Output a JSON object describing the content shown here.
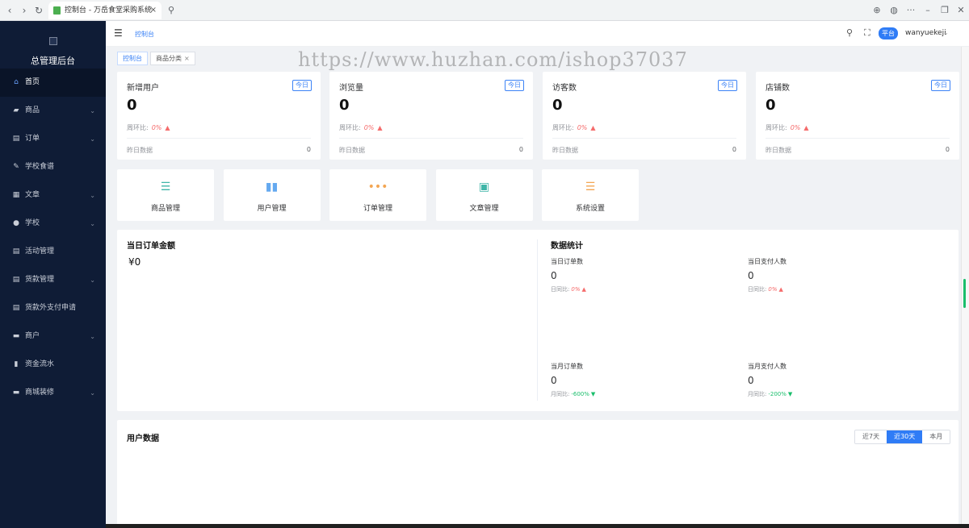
{
  "browser": {
    "tab_title": "控制台 - 万岳食堂采购系统",
    "back": "‹",
    "forward": "›",
    "reload": "↻",
    "tab_close": "×",
    "search_glyph": "⚲",
    "download_glyph": "⊕",
    "globe_glyph": "◍",
    "more_glyph": "···",
    "min_glyph": "–",
    "restore_glyph": "❐",
    "close_glyph": "✕"
  },
  "sidebar": {
    "brand": "总管理后台",
    "items": [
      {
        "label": "首页",
        "icon": "home-icon",
        "glyph": "⌂",
        "arrow": false
      },
      {
        "label": "商品",
        "icon": "bag-icon",
        "glyph": "▰",
        "arrow": true
      },
      {
        "label": "订单",
        "icon": "order-icon",
        "glyph": "▤",
        "arrow": true
      },
      {
        "label": "学校食谱",
        "icon": "edit-icon",
        "glyph": "✎",
        "arrow": false
      },
      {
        "label": "文章",
        "icon": "article-icon",
        "glyph": "▦",
        "arrow": true
      },
      {
        "label": "学校",
        "icon": "user-icon",
        "glyph": "●",
        "arrow": true
      },
      {
        "label": "活动管理",
        "icon": "list-icon",
        "glyph": "▤",
        "arrow": false
      },
      {
        "label": "货款管理",
        "icon": "doc-icon",
        "glyph": "▤",
        "arrow": true
      },
      {
        "label": "货款外支付申请",
        "icon": "doc-icon",
        "glyph": "▤",
        "arrow": false
      },
      {
        "label": "商户",
        "icon": "shop-icon",
        "glyph": "▬",
        "arrow": true
      },
      {
        "label": "资金流水",
        "icon": "bar-chart-icon",
        "glyph": "▮",
        "arrow": false
      },
      {
        "label": "商城装修",
        "icon": "brush-icon",
        "glyph": "▬",
        "arrow": true
      }
    ],
    "arrow_glyph": "⌄"
  },
  "header": {
    "menu_glyph": "☰",
    "breadcrumb": "控制台",
    "search_glyph": "⚲",
    "fullscreen_glyph": "⛶",
    "platform": "平台",
    "username": "wanyuekeji",
    "caret": "⌄"
  },
  "page_tabs": {
    "home": "控制台",
    "category": "商品分类",
    "close": "×"
  },
  "watermark": "https://www.huzhan.com/ishop37037",
  "stats": [
    {
      "title": "新增用户",
      "badge": "今日",
      "value": "0",
      "wow_label": "周环比:",
      "wow": "0%",
      "yday_label": "昨日数据",
      "yday": "0"
    },
    {
      "title": "浏览量",
      "badge": "今日",
      "value": "0",
      "wow_label": "周环比:",
      "wow": "0%",
      "yday_label": "昨日数据",
      "yday": "0"
    },
    {
      "title": "访客数",
      "badge": "今日",
      "value": "0",
      "wow_label": "周环比:",
      "wow": "0%",
      "yday_label": "昨日数据",
      "yday": "0"
    },
    {
      "title": "店铺数",
      "badge": "今日",
      "value": "0",
      "wow_label": "周环比:",
      "wow": "0%",
      "yday_label": "昨日数据",
      "yday": "0"
    }
  ],
  "up_arrow": "▲",
  "down_arrow": "▼",
  "shortcuts": [
    {
      "label": "商品管理",
      "glyph": "☰",
      "color": "#3fb5a8",
      "icon": "goods-list-icon"
    },
    {
      "label": "用户管理",
      "glyph": "▮▮",
      "color": "#64a9f0",
      "icon": "bar-chart-icon"
    },
    {
      "label": "订单管理",
      "glyph": "•••",
      "color": "#f3a653",
      "icon": "more-dots-icon"
    },
    {
      "label": "文章管理",
      "glyph": "▣",
      "color": "#3fb5a8",
      "icon": "image-icon"
    },
    {
      "label": "系统设置",
      "glyph": "☰",
      "color": "#f3a653",
      "icon": "settings-list-icon"
    }
  ],
  "order_panel": {
    "title": "当日订单金额",
    "amount": "¥0"
  },
  "data_stats": {
    "title": "数据统计",
    "items": [
      {
        "label": "当日订单数",
        "value": "0",
        "cmp_label": "日同比:",
        "cmp": "0%",
        "dir": "up"
      },
      {
        "label": "当日支付人数",
        "value": "0",
        "cmp_label": "日同比:",
        "cmp": "0%",
        "dir": "up"
      },
      {
        "label": "当月订单数",
        "value": "0",
        "cmp_label": "月同比:",
        "cmp": "-600%",
        "dir": "down"
      },
      {
        "label": "当月支付人数",
        "value": "0",
        "cmp_label": "月同比:",
        "cmp": "-200%",
        "dir": "down"
      }
    ]
  },
  "user_data": {
    "title": "用户数据",
    "ranges": [
      "近7天",
      "近30天",
      "本月"
    ],
    "active_range": "近30天"
  },
  "colors": {
    "sidebar_bg": "#0f1c36",
    "accent": "#2f7cf6",
    "up": "#f56c6c",
    "down": "#19be6b"
  }
}
